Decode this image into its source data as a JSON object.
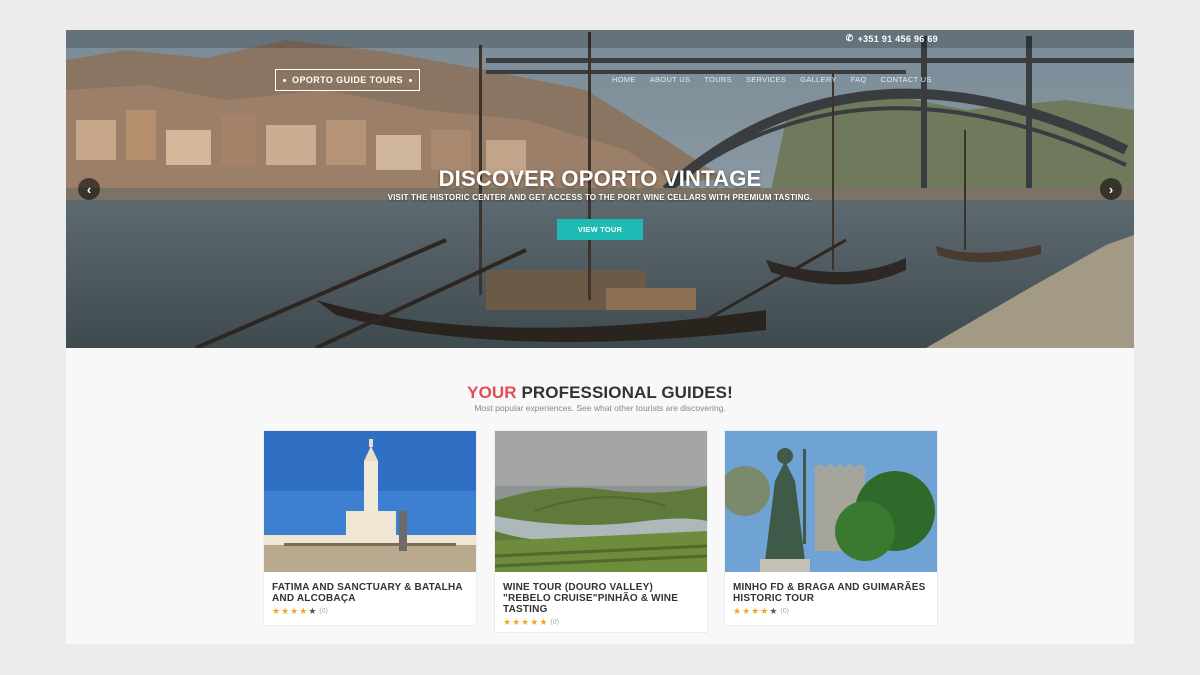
{
  "header": {
    "phone": "+351 91 456 96 69",
    "logo": "OPORTO GUIDE TOURS",
    "nav": [
      "HOME",
      "ABOUT US",
      "TOURS",
      "SERVICES",
      "GALLERY",
      "FAQ",
      "CONTACT US"
    ]
  },
  "hero": {
    "title": "DISCOVER OPORTO VINTAGE",
    "subtitle": "VISIT THE HISTORIC CENTER AND GET ACCESS TO THE PORT WINE CELLARS WITH PREMIUM TASTING.",
    "button": "VIEW TOUR",
    "prev_icon": "chevron-left-icon",
    "next_icon": "chevron-right-icon"
  },
  "section": {
    "title_accent": "YOUR",
    "title_rest": " PROFESSIONAL GUIDES!",
    "subtitle": "Most popular experiences. See what other tourists are discovering."
  },
  "tours": [
    {
      "title": "FATIMA AND SANCTUARY & BATALHA AND ALCOBAÇA",
      "rating": 4,
      "count": "(0)"
    },
    {
      "title": "WINE TOUR (DOURO VALLEY) \"REBELO CRUISE\"PINHÃO & WINE TASTING",
      "rating": 5,
      "count": "(0)"
    },
    {
      "title": "MINHO FD & BRAGA AND GUIMARÃES HISTORIC TOUR",
      "rating": 4,
      "count": "(0)"
    }
  ],
  "colors": {
    "accent_red": "#e14d57",
    "button_teal": "#1cbbb4",
    "star": "#f5a623"
  }
}
